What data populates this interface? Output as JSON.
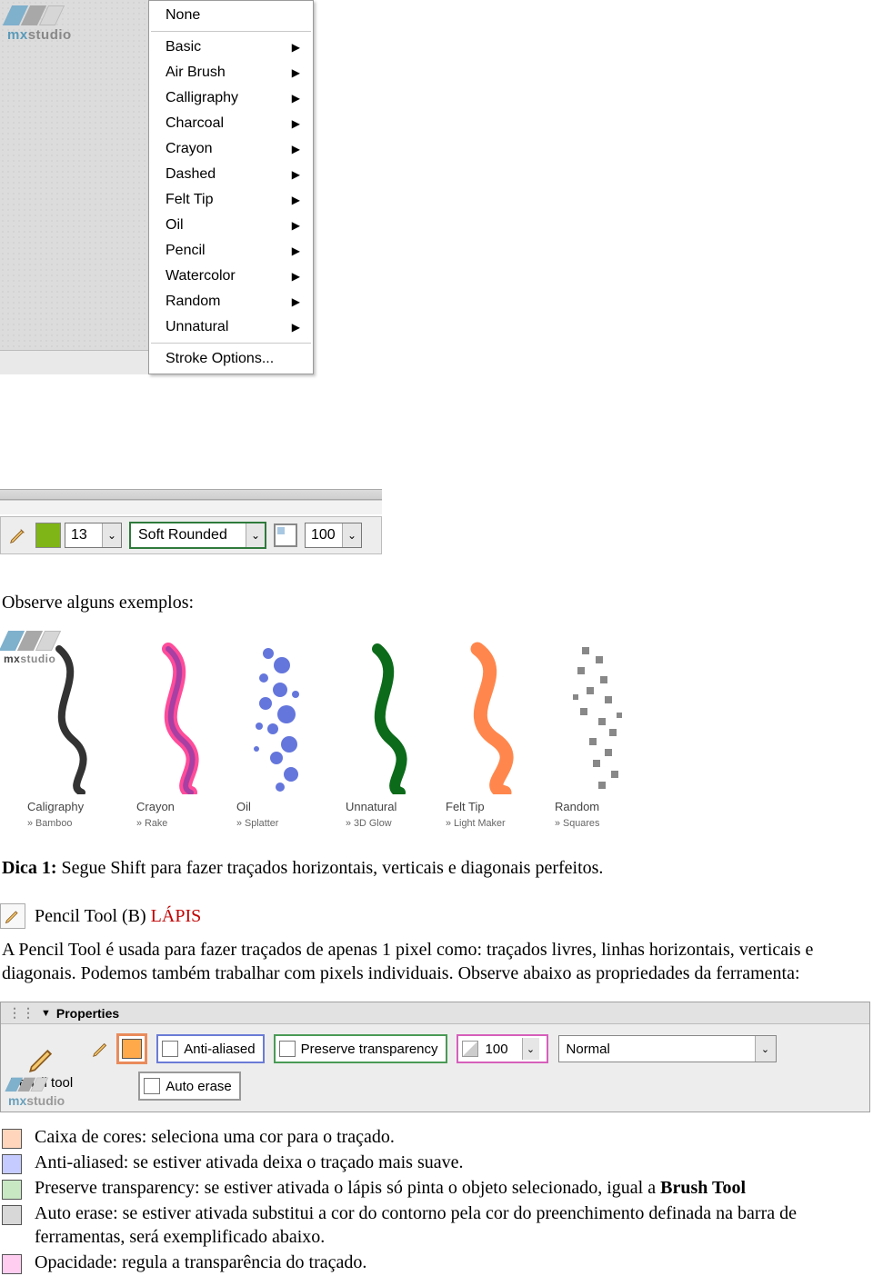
{
  "menu": {
    "items": [
      {
        "label": "None",
        "submenu": false
      },
      {
        "sep": true
      },
      {
        "label": "Basic",
        "submenu": true
      },
      {
        "label": "Air Brush",
        "submenu": true
      },
      {
        "label": "Calligraphy",
        "submenu": true
      },
      {
        "label": "Charcoal",
        "submenu": true
      },
      {
        "label": "Crayon",
        "submenu": true
      },
      {
        "label": "Dashed",
        "submenu": true
      },
      {
        "label": "Felt Tip",
        "submenu": true
      },
      {
        "label": "Oil",
        "submenu": true
      },
      {
        "label": "Pencil",
        "submenu": true
      },
      {
        "label": "Watercolor",
        "submenu": true
      },
      {
        "label": "Random",
        "submenu": true
      },
      {
        "label": "Unnatural",
        "submenu": true
      },
      {
        "sep": true
      },
      {
        "label": "Stroke Options...",
        "submenu": false
      }
    ]
  },
  "toolbar1": {
    "size_value": "13",
    "brush_value": "Soft Rounded",
    "opacity_value": "100"
  },
  "logo": {
    "text_a": "mx",
    "text_b": "studio"
  },
  "text": {
    "observe_examples": "Observe alguns exemplos:",
    "tip1_label": "Dica 1:",
    "tip1_body": " Segue Shift para fazer traçados horizontais, verticais e diagonais perfeitos.",
    "pencil_tool_label": "Pencil Tool (B) ",
    "pencil_red": "LÁPIS",
    "pencil_para": "A Pencil Tool é usada para fazer traçados de apenas 1 pixel como: traçados livres, linhas horizontais, verticais e diagonais. Podemos também trabalhar com pixels individuais. Observe abaixo as propriedades da ferramenta:"
  },
  "examples": [
    {
      "name": "Caligraphy",
      "sub": "» Bamboo"
    },
    {
      "name": "Crayon",
      "sub": "» Rake"
    },
    {
      "name": "Oil",
      "sub": "» Splatter"
    },
    {
      "name": "Unnatural",
      "sub": "» 3D Glow"
    },
    {
      "name": "Felt Tip",
      "sub": "» Light Maker"
    },
    {
      "name": "Random",
      "sub": "» Squares"
    }
  ],
  "properties": {
    "header": "Properties",
    "toolname": "Pencil tool",
    "anti_aliased": "Anti-aliased",
    "preserve_transparency": "Preserve transparency",
    "auto_erase": "Auto erase",
    "opacity_value": "100",
    "blend_mode": "Normal"
  },
  "legend": {
    "color_box": "Caixa de cores: seleciona uma cor para o traçado.",
    "anti_aliased": "Anti-aliased: se estiver ativada deixa o traçado mais suave.",
    "preserve_a": "Preserve transparency: se estiver ativada o lápis só pinta o objeto selecionado, igual a ",
    "preserve_b": "Brush Tool",
    "auto_erase": "Auto erase: se estiver ativada substitui a cor do contorno pela cor do preenchimento definada na barra de ferramentas, será exemplificado abaixo.",
    "opacity": "Opacidade: regula a transparência do traçado."
  }
}
